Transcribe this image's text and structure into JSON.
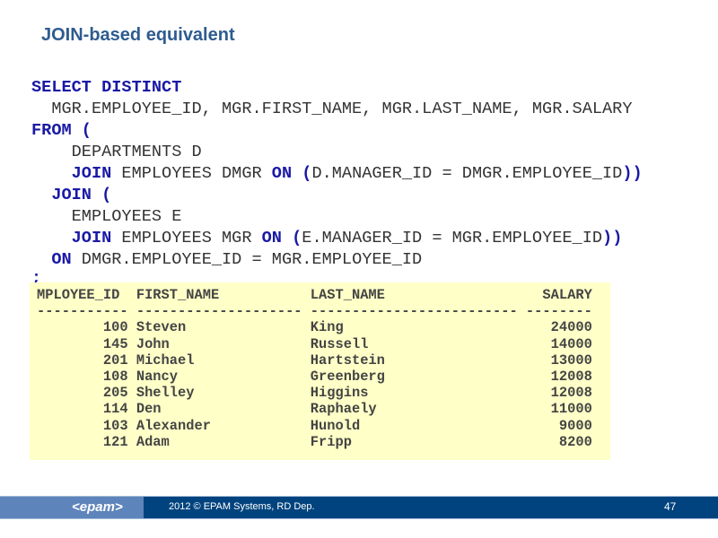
{
  "title": "JOIN-based equivalent",
  "code_lines": [
    [
      {
        "t": "SELECT DISTINCT",
        "k": true
      }
    ],
    [
      {
        "t": "  MGR.EMPLOYEE_ID, MGR.FIRST_NAME, MGR.LAST_NAME, MGR.SALARY",
        "k": false
      }
    ],
    [
      {
        "t": "FROM (",
        "k": true
      }
    ],
    [
      {
        "t": "    DEPARTMENTS D",
        "k": false
      }
    ],
    [
      {
        "t": "    JOIN",
        "k": true
      },
      {
        "t": " EMPLOYEES DMGR ",
        "k": false
      },
      {
        "t": "ON (",
        "k": true
      },
      {
        "t": "D.MANAGER_ID = DMGR.EMPLOYEE_ID",
        "k": false
      },
      {
        "t": "))",
        "k": true
      }
    ],
    [
      {
        "t": "  JOIN (",
        "k": true
      }
    ],
    [
      {
        "t": "    EMPLOYEES E",
        "k": false
      }
    ],
    [
      {
        "t": "    JOIN",
        "k": true
      },
      {
        "t": " EMPLOYEES MGR ",
        "k": false
      },
      {
        "t": "ON (",
        "k": true
      },
      {
        "t": "E.MANAGER_ID = MGR.EMPLOYEE_ID",
        "k": false
      },
      {
        "t": "))",
        "k": true
      }
    ],
    [
      {
        "t": "  ON",
        "k": true
      },
      {
        "t": " DMGR.EMPLOYEE_ID = MGR.EMPLOYEE_ID",
        "k": false
      }
    ]
  ],
  "terminator": ";",
  "result": {
    "headers": [
      "MPLOYEE_ID",
      "FIRST_NAME",
      "LAST_NAME",
      "SALARY"
    ],
    "rows": [
      [
        "100",
        "Steven",
        "King",
        "24000"
      ],
      [
        "145",
        "John",
        "Russell",
        "14000"
      ],
      [
        "201",
        "Michael",
        "Hartstein",
        "13000"
      ],
      [
        "108",
        "Nancy",
        "Greenberg",
        "12008"
      ],
      [
        "205",
        "Shelley",
        "Higgins",
        "12008"
      ],
      [
        "114",
        "Den",
        "Raphaely",
        "11000"
      ],
      [
        "103",
        "Alexander",
        "Hunold",
        "9000"
      ],
      [
        "121",
        "Adam",
        "Fripp",
        "8200"
      ]
    ]
  },
  "footer": {
    "logo": "<epam>",
    "copyright": "2012 © EPAM Systems, RD Dep.",
    "page": "47"
  },
  "colors": {
    "title": "#2e5c8f",
    "keyword": "#1a1aa6",
    "result_bg": "#ffffc8",
    "footer": "#00437e"
  }
}
